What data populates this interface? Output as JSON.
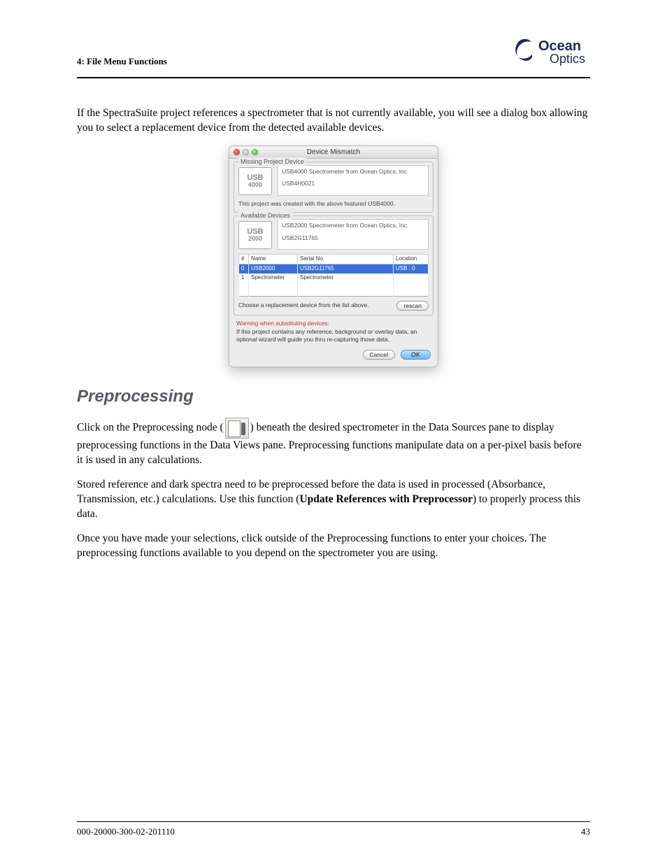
{
  "header": {
    "breadcrumb": "4: File Menu Functions",
    "logo": {
      "top": "Ocean",
      "bottom": "Optics"
    }
  },
  "intro": {
    "p1": "If the SpectraSuite project references a spectrometer that is not currently available, you will see a dialog box allowing you to select a replacement device from the detected available devices."
  },
  "dialog": {
    "title": "Device Mismatch",
    "missing": {
      "legend": "Missing Project Device",
      "icon": {
        "l1": "USB",
        "l2": "4000"
      },
      "desc1": "USB4000 Spectrometer from Ocean Optics, Inc.",
      "serial": "USB4H0021",
      "note": "This project was created with the above featured USB4000."
    },
    "available": {
      "legend": "Available Devices",
      "icon": {
        "l1": "USB",
        "l2": "2000"
      },
      "desc1": "USB2000 Spectrometer from Ocean Optics, Inc.",
      "serial": "USB2G11765",
      "table": {
        "headers": {
          "num": "#",
          "name": "Name",
          "serial": "Serial No.",
          "loc": "Location"
        },
        "rows": [
          {
            "num": "0",
            "name": "USB2000",
            "serial": "USB2G11765",
            "loc": "USB : 0",
            "selected": true
          },
          {
            "num": "1",
            "name": "Spectrometer",
            "serial": "Spectrometer",
            "loc": "",
            "selected": false
          }
        ]
      },
      "choose": "Choose a replacement device from the list above.",
      "rescan": "rescan"
    },
    "warning": {
      "title": "Warning when substituting devices:",
      "body": "If this project contains any reference, background or overlay data, an optional wizard will guide you thru re-capturing those data."
    },
    "actions": {
      "cancel": "Cancel",
      "ok": "OK"
    }
  },
  "section": {
    "heading": "Preprocessing",
    "p_lead": "Click on the Preprocessing node (",
    "p_tail": ") beneath the desired spectrometer in the Data Sources pane to display preprocessing functions in the Data Views pane. Preprocessing functions manipulate data on a per-pixel basis before it is used in any calculations.",
    "p2_a": "Stored reference and dark spectra need to be preprocessed before the data is used in processed (Absorbance, Transmission, etc.) calculations. Use this function (",
    "p2_bold": "Update References with Preprocessor",
    "p2_b": ") to properly process this data.",
    "p3": "Once you have made your selections, click outside of the Preprocessing functions to enter your choices. The preprocessing functions available to you depend on the spectrometer you are using."
  },
  "footer": {
    "docnum": "000-20000-300-02-201110",
    "page": "43"
  }
}
